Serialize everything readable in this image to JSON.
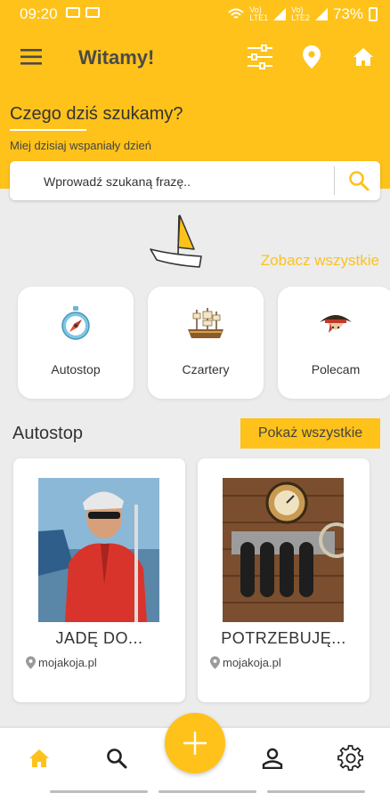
{
  "status_bar": {
    "time": "09:20",
    "battery": "73%"
  },
  "app_bar": {
    "title": "Witamy!"
  },
  "hero": {
    "heading": "Czego dziś szukamy?",
    "subheading": "Miej dzisiaj wspaniały dzień",
    "search_placeholder": "Wprowadź szukaną frazę.."
  },
  "categories": {
    "see_all": "Zobacz wszystkie",
    "items": [
      {
        "label": "Autostop",
        "icon": "compass-icon"
      },
      {
        "label": "Czartery",
        "icon": "ship-icon"
      },
      {
        "label": "Polecam",
        "icon": "pirate-hat-icon"
      }
    ]
  },
  "autostop": {
    "title": "Autostop",
    "show_all": "Pokaż wszystkie",
    "listings": [
      {
        "title": "JADĘ DO...",
        "source": "mojakoja.pl",
        "image": "sailor-photo"
      },
      {
        "title": "POTRZEBUJĘ...",
        "source": "mojakoja.pl",
        "image": "boat-equipment-photo"
      }
    ]
  },
  "colors": {
    "accent": "#fec21a",
    "background": "#ececec",
    "text": "#333333"
  }
}
